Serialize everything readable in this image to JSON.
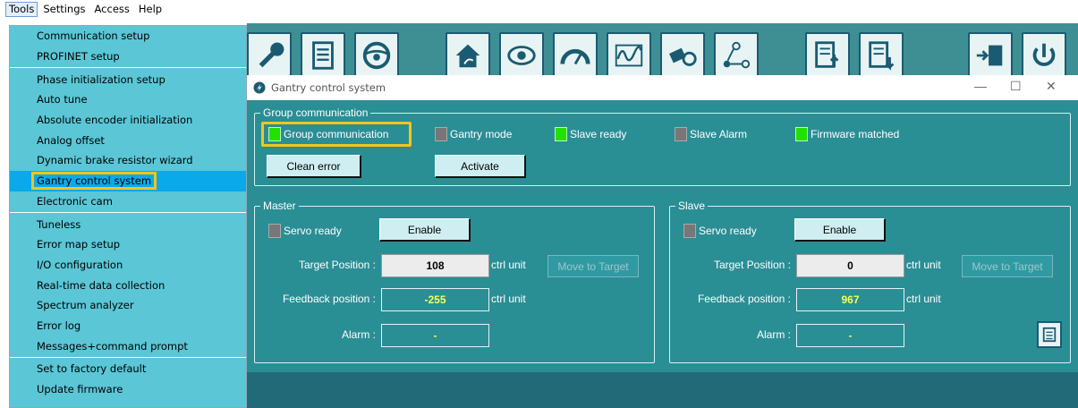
{
  "menubar": {
    "items": [
      "Tools",
      "Settings",
      "Access",
      "Help"
    ]
  },
  "tools_menu": {
    "groups": [
      [
        "Communication setup",
        "PROFINET setup"
      ],
      [
        "Phase initialization setup",
        "Auto tune",
        "Absolute encoder initialization",
        "Analog offset",
        "Dynamic brake resistor wizard",
        "Gantry control system",
        "Electronic cam"
      ],
      [
        "Tuneless",
        "Error map setup",
        "I/O configuration",
        "Real-time data collection",
        "Spectrum analyzer",
        "Error log",
        "Messages+command prompt"
      ],
      [
        "Set to factory default",
        "Update firmware"
      ]
    ],
    "selected": "Gantry control system"
  },
  "toolbar_icons": [
    "wrench-icon",
    "document-icon",
    "steering-wheel-icon",
    "home-icon",
    "eye-icon",
    "gauge-icon",
    "waveform-icon",
    "mechanism-icon",
    "network-icon",
    "document-up-icon",
    "document-down-icon",
    "chip-arrow-icon",
    "power-icon"
  ],
  "window": {
    "title": "Gantry control system",
    "group_comm": {
      "legend": "Group communication",
      "indicators": [
        {
          "label": "Group communication",
          "state": "green"
        },
        {
          "label": "Gantry mode",
          "state": "gray"
        },
        {
          "label": "Slave ready",
          "state": "green"
        },
        {
          "label": "Slave Alarm",
          "state": "gray"
        },
        {
          "label": "Firmware matched",
          "state": "green"
        }
      ],
      "clean_error": "Clean error",
      "activate": "Activate"
    },
    "master": {
      "legend": "Master",
      "servo_ready": "Servo ready",
      "enable": "Enable",
      "target_label": "Target Position :",
      "target_value": "108",
      "unit": "ctrl unit",
      "move": "Move to Target",
      "feedback_label": "Feedback position :",
      "feedback_value": "-255",
      "alarm_label": "Alarm :",
      "alarm_value": "-"
    },
    "slave": {
      "legend": "Slave",
      "servo_ready": "Servo ready",
      "enable": "Enable",
      "target_label": "Target Position :",
      "target_value": "0",
      "unit": "ctrl unit",
      "move": "Move to Target",
      "feedback_label": "Feedback position :",
      "feedback_value": "967",
      "alarm_label": "Alarm :",
      "alarm_value": "-"
    }
  },
  "colors": {
    "accent_highlight": "#f5c518",
    "panel_teal": "#2a8e95",
    "led_green": "#22e000",
    "value_yellow": "#f4ff5a",
    "menu_bg": "#5ac6d6",
    "menu_selected": "#0aa9ea"
  }
}
